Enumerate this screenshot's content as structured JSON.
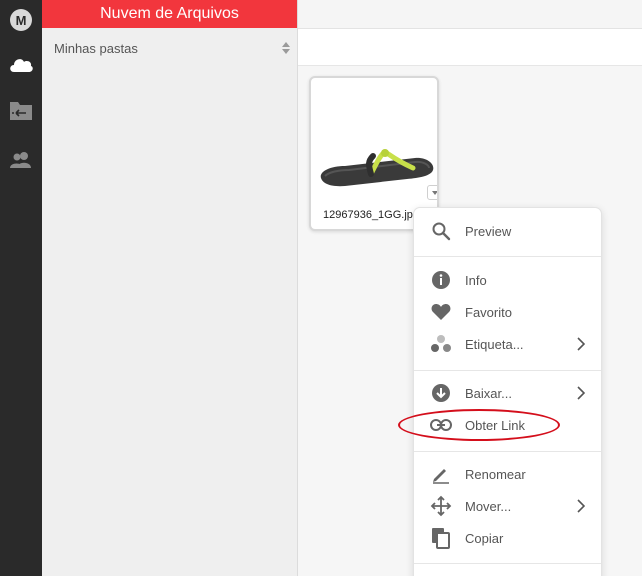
{
  "app": {
    "logo_letter": "M",
    "brand_color": "#f2363d"
  },
  "rail": {
    "items": [
      {
        "icon": "mega-logo-icon"
      },
      {
        "icon": "cloud-icon"
      },
      {
        "icon": "folder-transfer-icon"
      },
      {
        "icon": "contacts-icon"
      }
    ]
  },
  "sidebar": {
    "title": "Nuvem de Arquivos",
    "tree_label": "Minhas pastas"
  },
  "file": {
    "name": "12967936_1GG.jpg"
  },
  "context_menu": {
    "items": [
      {
        "label": "Preview",
        "icon": "search-icon",
        "submenu": false
      },
      {
        "label": "Info",
        "icon": "info-icon",
        "submenu": false
      },
      {
        "label": "Favorito",
        "icon": "heart-icon",
        "submenu": false
      },
      {
        "label": "Etiqueta...",
        "icon": "tag-dots-icon",
        "submenu": true
      },
      {
        "label": "Baixar...",
        "icon": "download-icon",
        "submenu": true
      },
      {
        "label": "Obter Link",
        "icon": "link-icon",
        "submenu": false,
        "highlighted": true
      },
      {
        "label": "Renomear",
        "icon": "pencil-icon",
        "submenu": false
      },
      {
        "label": "Mover...",
        "icon": "move-icon",
        "submenu": true
      },
      {
        "label": "Copiar",
        "icon": "copy-icon",
        "submenu": false
      }
    ]
  },
  "annotation": {
    "highlight_color": "#d40e1b"
  }
}
